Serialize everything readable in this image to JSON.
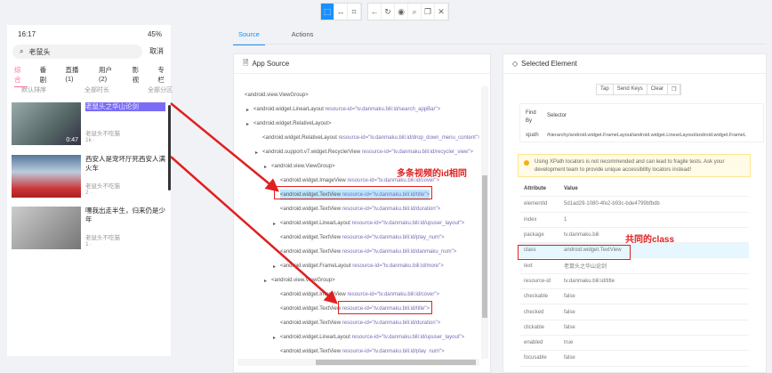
{
  "toolbar": {
    "icons": [
      "select-icon",
      "swipe-icon",
      "tap-coordinates-icon",
      "back-icon",
      "refresh-icon",
      "eye-icon",
      "search-icon",
      "copy-icon",
      "close-icon"
    ]
  },
  "phone": {
    "status_time": "16:17",
    "status_right": "45%",
    "search_value": "老鼠头",
    "cancel": "取消",
    "tabs": [
      "综合",
      "番剧",
      "直播(1)",
      "用户(2)",
      "影视",
      "专栏"
    ],
    "filters": [
      "默认排序",
      "全部时长",
      "全部分区"
    ],
    "videos": [
      {
        "title": "老鼠头之华山论剑",
        "duration": "0:47",
        "uploader": "老鼠头不吃猫",
        "stats": "1k  ·"
      },
      {
        "title": "西安人是宠坏厅死西安人满火车",
        "duration": "",
        "uploader": "老鼠头不吃猫",
        "stats": "2  ·"
      },
      {
        "title": "嘿我出走半生，归来仍是少年",
        "duration": "",
        "uploader": "老鼠头不吃猫",
        "stats": "1  ·"
      }
    ]
  },
  "tabs": {
    "source": "Source",
    "actions": "Actions"
  },
  "app_source": {
    "title": "App Source",
    "rows": [
      {
        "l": 0,
        "b": false,
        "t": "<android.view.ViewGroup>",
        "a": ""
      },
      {
        "l": 1,
        "b": true,
        "t": "<android.widget.LinearLayout ",
        "a": "resource-id=\"tv.danmaku.bili:id/search_appBar\">"
      },
      {
        "l": 1,
        "b": true,
        "t": "<android.widget.RelativeLayout>",
        "a": ""
      },
      {
        "l": 2,
        "b": false,
        "t": "<android.widget.RelativeLayout ",
        "a": "resource-id=\"tv.danmaku.bili:id/drop_down_menu_content\">"
      },
      {
        "l": 2,
        "b": true,
        "t": "<android.support.v7.widget.RecyclerView ",
        "a": "resource-id=\"tv.danmaku.bili:id/recycler_view\">"
      },
      {
        "l": 3,
        "b": true,
        "t": "<android.view.ViewGroup>",
        "a": ""
      },
      {
        "l": 4,
        "b": false,
        "t": "<android.widget.ImageView ",
        "a": "resource-id=\"tv.danmaku.bili:id/cover\">"
      },
      {
        "l": 4,
        "b": false,
        "t": "<android.widget.TextView ",
        "a": "resource-id=\"tv.danmaku.bili:id/title\">",
        "hl": true
      },
      {
        "l": 4,
        "b": false,
        "t": "<android.widget.TextView ",
        "a": "resource-id=\"tv.danmaku.bili:id/duration\">"
      },
      {
        "l": 4,
        "b": true,
        "t": "<android.widget.LinearLayout ",
        "a": "resource-id=\"tv.danmaku.bili:id/upuser_layout\">"
      },
      {
        "l": 4,
        "b": false,
        "t": "<android.widget.TextView ",
        "a": "resource-id=\"tv.danmaku.bili:id/play_num\">"
      },
      {
        "l": 4,
        "b": false,
        "t": "<android.widget.TextView ",
        "a": "resource-id=\"tv.danmaku.bili:id/danmaku_num\">"
      },
      {
        "l": 4,
        "b": true,
        "t": "<android.widget.FrameLayout ",
        "a": "resource-id=\"tv.danmaku.bili:id/more\">"
      },
      {
        "l": 3,
        "b": true,
        "t": "<android.view.ViewGroup>",
        "a": ""
      },
      {
        "l": 4,
        "b": false,
        "t": "<android.widget.ImageView ",
        "a": "resource-id=\"tv.danmaku.bili:id/cover\">"
      },
      {
        "l": 4,
        "b": false,
        "t": "<android.widget.TextView ",
        "a": "resource-id=\"tv.danmaku.bili:id/title\">"
      },
      {
        "l": 4,
        "b": false,
        "t": "<android.widget.TextView ",
        "a": "resource-id=\"tv.danmaku.bili:id/duration\">"
      },
      {
        "l": 4,
        "b": true,
        "t": "<android.widget.LinearLayout ",
        "a": "resource-id=\"tv.danmaku.bili:id/upuser_layout\">"
      },
      {
        "l": 4,
        "b": false,
        "t": "<android.widget.TextView ",
        "a": "resource-id=\"tv.danmaku.bili:id/play_num\">"
      }
    ]
  },
  "selected": {
    "title": "Selected Element",
    "buttons": [
      "Tap",
      "Send Keys",
      "Clear"
    ],
    "find_by_header": "Find By",
    "selector_header": "Selector",
    "find_by": "xpath",
    "selector": "/hierarchy/android.widget.FrameLayout/android.widget.LinearLayout/android.widget.FrameL",
    "warning": "Using XPath locators is not recommended and can lead to fragile tests. Ask your development team to provide unique accessibility locators instead!",
    "attr_header": "Attribute",
    "value_header": "Value",
    "attributes": [
      [
        "elementId",
        "5d1ad29-1080-4fe2-b93c-bde4799bfbdb"
      ],
      [
        "index",
        "1"
      ],
      [
        "package",
        "tv.danmaku.bili"
      ],
      [
        "class",
        "android.widget.TextView"
      ],
      [
        "text",
        "老鼠头之华山论剑"
      ],
      [
        "resource-id",
        "tv.danmaku.bili:id/title"
      ],
      [
        "checkable",
        "false"
      ],
      [
        "checked",
        "false"
      ],
      [
        "clickable",
        "false"
      ],
      [
        "enabled",
        "true"
      ],
      [
        "focusable",
        "false"
      ]
    ]
  },
  "annotations": {
    "same_id": "多条视频的id相同",
    "same_class": "共同的class"
  },
  "colors": {
    "accent": "#1890ff",
    "annotation": "#e02020",
    "highlight": "#bae7ff"
  }
}
